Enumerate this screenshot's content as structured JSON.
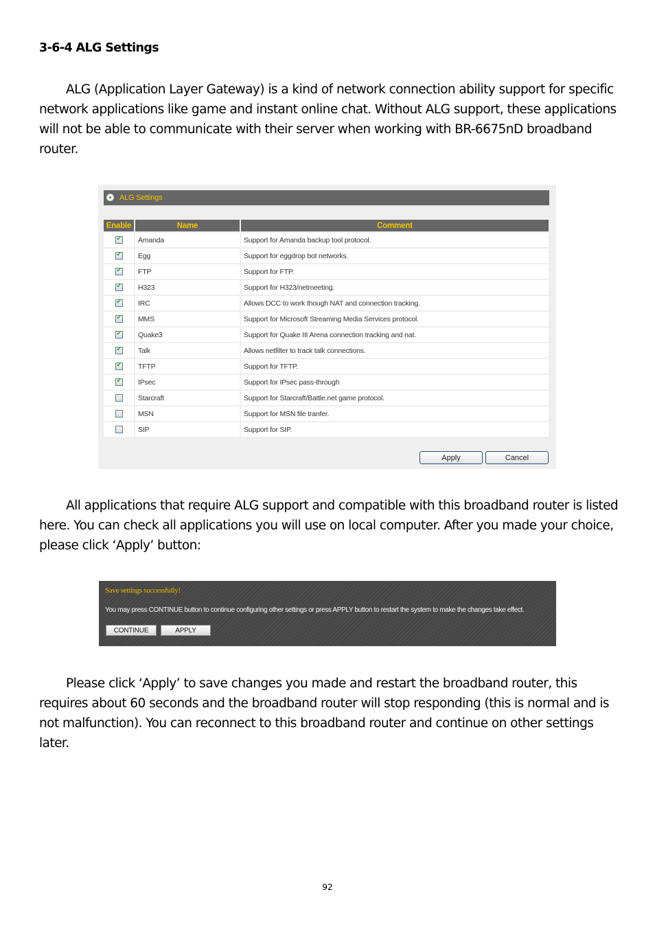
{
  "heading": "3-6-4 ALG Settings",
  "paragraphs": {
    "intro": "ALG (Application Layer Gateway) is a kind of network connection ability support for specific network applications like game and instant online chat. Without ALG support, these applications will not be able to communicate with their server when working with BR-6675nD broadband router.",
    "middle": "All applications that require ALG support and compatible with this broadband router is listed here. You can check all applications you will use on local computer. After you made your choice, please click ‘Apply’ button:",
    "closing": "Please click ‘Apply’ to save changes you made and restart the broadband router, this requires about 60 seconds and the broadband router will stop responding (this is normal and is not malfunction). You can reconnect to this broadband router and continue on other settings later."
  },
  "alg_panel": {
    "title": "ALG Settings",
    "header_icon": "radio-bullet-icon",
    "columns": {
      "enable": "Enable",
      "name": "Name",
      "comment": "Comment"
    },
    "rows": [
      {
        "enabled": true,
        "name": "Amanda",
        "comment": "Support for Amanda backup tool protocol."
      },
      {
        "enabled": true,
        "name": "Egg",
        "comment": "Support for eggdrop bot networks."
      },
      {
        "enabled": true,
        "name": "FTP",
        "comment": "Support for FTP."
      },
      {
        "enabled": true,
        "name": "H323",
        "comment": "Support for H323/netmeeting."
      },
      {
        "enabled": true,
        "name": "IRC",
        "comment": "Allows DCC to work though NAT and connection tracking."
      },
      {
        "enabled": true,
        "name": "MMS",
        "comment": "Support for Microsoft Streaming Media Services protocol."
      },
      {
        "enabled": true,
        "name": "Quake3",
        "comment": "Support for Quake III Arena connection tracking and nat."
      },
      {
        "enabled": true,
        "name": "Talk",
        "comment": "Allows netfilter to track talk connections."
      },
      {
        "enabled": true,
        "name": "TFTP",
        "comment": "Support for TFTP."
      },
      {
        "enabled": true,
        "name": "IPsec",
        "comment": "Support for IPsec pass-through"
      },
      {
        "enabled": false,
        "name": "Starcraft",
        "comment": "Support for Starcraft/Battle.net game protocol."
      },
      {
        "enabled": false,
        "name": "MSN",
        "comment": "Support for MSN file tranfer."
      },
      {
        "enabled": false,
        "name": "SIP",
        "comment": "Support for SIP."
      }
    ],
    "apply_label": "Apply",
    "cancel_label": "Cancel"
  },
  "save_dialog": {
    "title": "Save settings successfully!",
    "message": "You may press CONTINUE button to continue configuring other settings or press APPLY button to restart the system to make the changes take effect.",
    "continue_label": "CONTINUE",
    "apply_label": "APPLY"
  },
  "colors": {
    "header_bg": "#666666",
    "header_text": "#f5c400",
    "panel_bg": "#efefef",
    "dialog_bg": "#444444",
    "dialog_title": "#e8b800"
  },
  "page_number": "92"
}
